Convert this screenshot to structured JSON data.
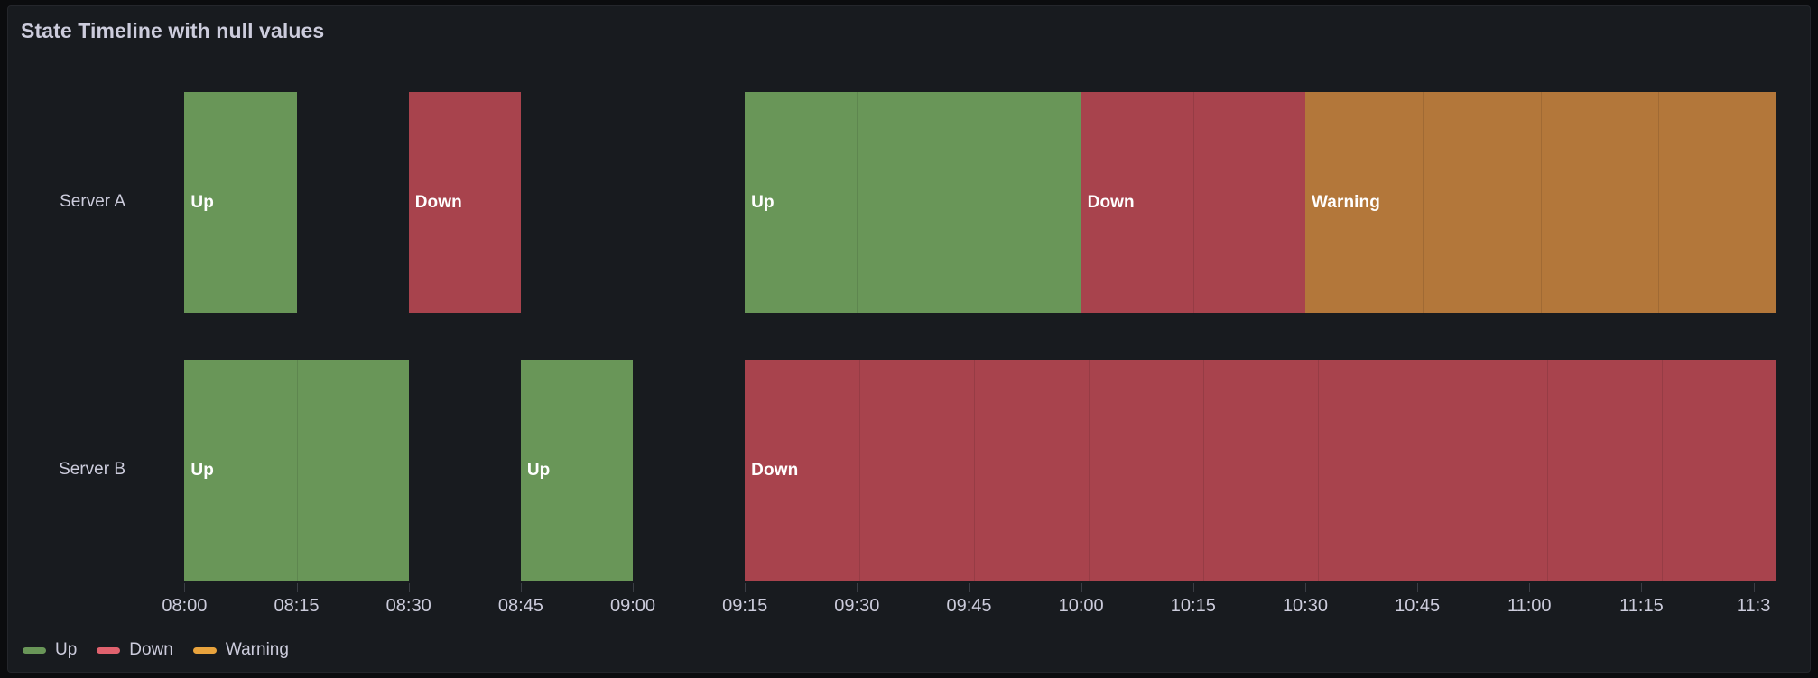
{
  "panel": {
    "title": "State Timeline with null values"
  },
  "chart_data": {
    "type": "state-timeline",
    "title": "State Timeline with null values",
    "xlabel": "",
    "ylabel": "",
    "grid": false,
    "legend_position": "bottom-left",
    "x_axis": {
      "min": "07:55",
      "max": "11:33",
      "tick_labels": [
        "08:00",
        "08:15",
        "08:30",
        "08:45",
        "09:00",
        "09:15",
        "09:30",
        "09:45",
        "10:00",
        "10:15",
        "10:30",
        "10:45",
        "11:00",
        "11:15",
        "11:3"
      ],
      "tick_minutes": [
        480,
        495,
        510,
        525,
        540,
        555,
        570,
        585,
        600,
        615,
        630,
        645,
        660,
        675,
        690
      ],
      "clipped_last_label": true
    },
    "state_colors": {
      "Up": "#699658",
      "Down": "#A8434D",
      "Warning": "#B3773A",
      "null": "#181b1f"
    },
    "rows": [
      {
        "label": "Server A",
        "segments": [
          {
            "state": "Up",
            "label": "Up",
            "start": 480,
            "end": 495,
            "color": "#699658",
            "divisions": 1
          },
          {
            "state": "null",
            "label": "",
            "start": 495,
            "end": 510,
            "color": "#181b1f",
            "divisions": 1
          },
          {
            "state": "Down",
            "label": "Down",
            "start": 510,
            "end": 525,
            "color": "#A8434D",
            "divisions": 1
          },
          {
            "state": "null",
            "label": "",
            "start": 525,
            "end": 555,
            "color": "#181b1f",
            "divisions": 1
          },
          {
            "state": "Up",
            "label": "Up",
            "start": 555,
            "end": 600,
            "color": "#699658",
            "divisions": 3
          },
          {
            "state": "Down",
            "label": "Down",
            "start": 600,
            "end": 630,
            "color": "#A8434D",
            "divisions": 2
          },
          {
            "state": "Warning",
            "label": "Warning",
            "start": 630,
            "end": 693,
            "color": "#B3773A",
            "divisions": 4
          }
        ]
      },
      {
        "label": "Server B",
        "segments": [
          {
            "state": "Up",
            "label": "Up",
            "start": 480,
            "end": 510,
            "color": "#699658",
            "divisions": 2
          },
          {
            "state": "null",
            "label": "",
            "start": 510,
            "end": 525,
            "color": "#181b1f",
            "divisions": 1
          },
          {
            "state": "Up",
            "label": "Up",
            "start": 525,
            "end": 540,
            "color": "#699658",
            "divisions": 1
          },
          {
            "state": "null",
            "label": "",
            "start": 540,
            "end": 555,
            "color": "#181b1f",
            "divisions": 1
          },
          {
            "state": "Down",
            "label": "Down",
            "start": 555,
            "end": 693,
            "color": "#A8434D",
            "divisions": 9
          }
        ]
      }
    ],
    "legend": [
      {
        "label": "Up",
        "color": "#699658"
      },
      {
        "label": "Down",
        "color": "#E0626E"
      },
      {
        "label": "Warning",
        "color": "#E8A33D"
      }
    ]
  }
}
